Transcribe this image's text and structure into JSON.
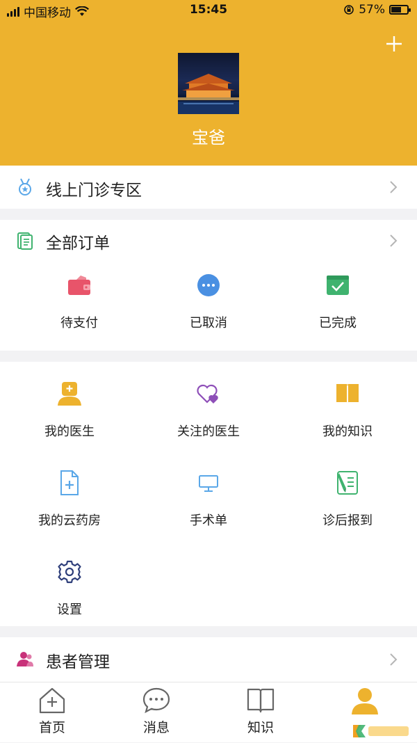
{
  "status_bar": {
    "carrier": "中国移动",
    "time": "15:45",
    "battery_text": "57%"
  },
  "profile": {
    "name": "宝爸"
  },
  "online_clinic": {
    "label": "线上门诊专区"
  },
  "orders": {
    "title": "全部订单",
    "items": [
      {
        "label": "待支付",
        "icon": "wallet-icon",
        "color": "#e8546a"
      },
      {
        "label": "已取消",
        "icon": "more-dots-icon",
        "color": "#4a90e2"
      },
      {
        "label": "已完成",
        "icon": "check-box-icon",
        "color": "#3fb36f"
      }
    ]
  },
  "services": [
    {
      "label": "我的医生",
      "icon": "doctor-icon",
      "color": "#edb22e"
    },
    {
      "label": "关注的医生",
      "icon": "hearts-icon",
      "color": "#8e4fb8"
    },
    {
      "label": "我的知识",
      "icon": "book-icon",
      "color": "#edb22e"
    },
    {
      "label": "我的云药房",
      "icon": "add-document-icon",
      "color": "#5aa7e8"
    },
    {
      "label": "手术单",
      "icon": "monitor-icon",
      "color": "#5aa7e8"
    },
    {
      "label": "诊后报到",
      "icon": "checklist-pen-icon",
      "color": "#3fb36f"
    },
    {
      "label": "设置",
      "icon": "gear-icon",
      "color": "#2e3e7a"
    }
  ],
  "patient_mgmt": {
    "label": "患者管理"
  },
  "tabs": [
    {
      "label": "首页",
      "icon": "home-icon"
    },
    {
      "label": "消息",
      "icon": "message-icon"
    },
    {
      "label": "知识",
      "icon": "book-open-icon"
    },
    {
      "label": "",
      "icon": "user-icon",
      "active": true
    }
  ],
  "colors": {
    "brand": "#edb22e"
  }
}
